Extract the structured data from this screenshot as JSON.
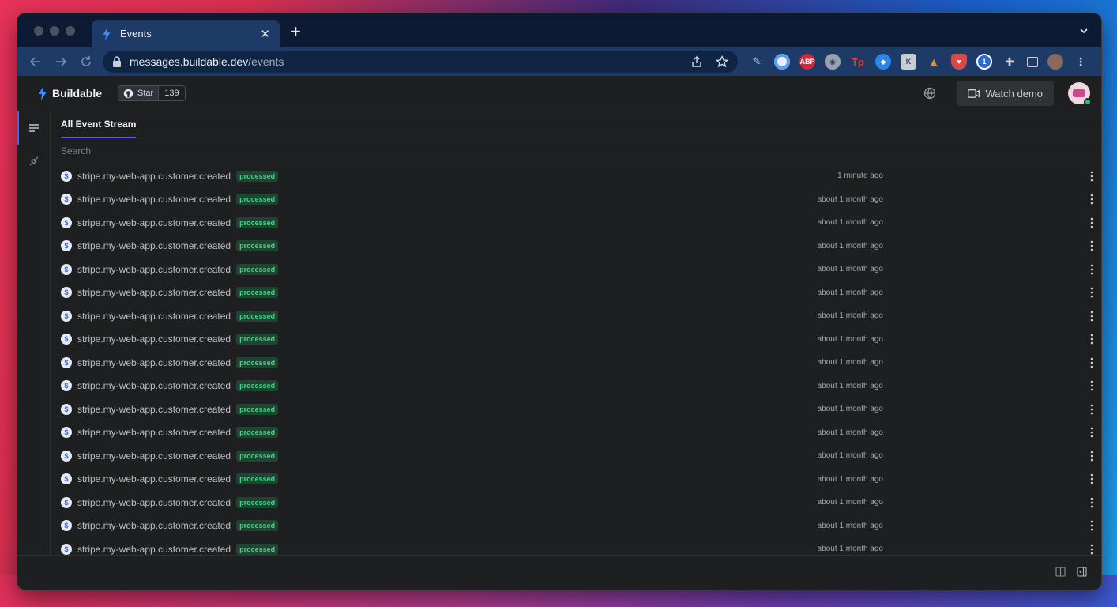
{
  "browser": {
    "tab_title": "Events",
    "url_host": "messages.buildable.dev",
    "url_path": "/events"
  },
  "header": {
    "brand_name": "Buildable",
    "github_star_label": "Star",
    "github_star_count": "139",
    "watch_demo_label": "Watch demo"
  },
  "main": {
    "tab_label": "All Event Stream",
    "search_placeholder": "Search"
  },
  "colors": {
    "accent": "#5b5ff0",
    "status_processed": "#47d18b"
  },
  "events": [
    {
      "name": "stripe.my-web-app.customer.created",
      "status": "processed",
      "time": "1 minute ago"
    },
    {
      "name": "stripe.my-web-app.customer.created",
      "status": "processed",
      "time": "about 1 month ago"
    },
    {
      "name": "stripe.my-web-app.customer.created",
      "status": "processed",
      "time": "about 1 month ago"
    },
    {
      "name": "stripe.my-web-app.customer.created",
      "status": "processed",
      "time": "about 1 month ago"
    },
    {
      "name": "stripe.my-web-app.customer.created",
      "status": "processed",
      "time": "about 1 month ago"
    },
    {
      "name": "stripe.my-web-app.customer.created",
      "status": "processed",
      "time": "about 1 month ago"
    },
    {
      "name": "stripe.my-web-app.customer.created",
      "status": "processed",
      "time": "about 1 month ago"
    },
    {
      "name": "stripe.my-web-app.customer.created",
      "status": "processed",
      "time": "about 1 month ago"
    },
    {
      "name": "stripe.my-web-app.customer.created",
      "status": "processed",
      "time": "about 1 month ago"
    },
    {
      "name": "stripe.my-web-app.customer.created",
      "status": "processed",
      "time": "about 1 month ago"
    },
    {
      "name": "stripe.my-web-app.customer.created",
      "status": "processed",
      "time": "about 1 month ago"
    },
    {
      "name": "stripe.my-web-app.customer.created",
      "status": "processed",
      "time": "about 1 month ago"
    },
    {
      "name": "stripe.my-web-app.customer.created",
      "status": "processed",
      "time": "about 1 month ago"
    },
    {
      "name": "stripe.my-web-app.customer.created",
      "status": "processed",
      "time": "about 1 month ago"
    },
    {
      "name": "stripe.my-web-app.customer.created",
      "status": "processed",
      "time": "about 1 month ago"
    },
    {
      "name": "stripe.my-web-app.customer.created",
      "status": "processed",
      "time": "about 1 month ago"
    },
    {
      "name": "stripe.my-web-app.customer.created",
      "status": "processed",
      "time": "about 1 month ago"
    }
  ]
}
